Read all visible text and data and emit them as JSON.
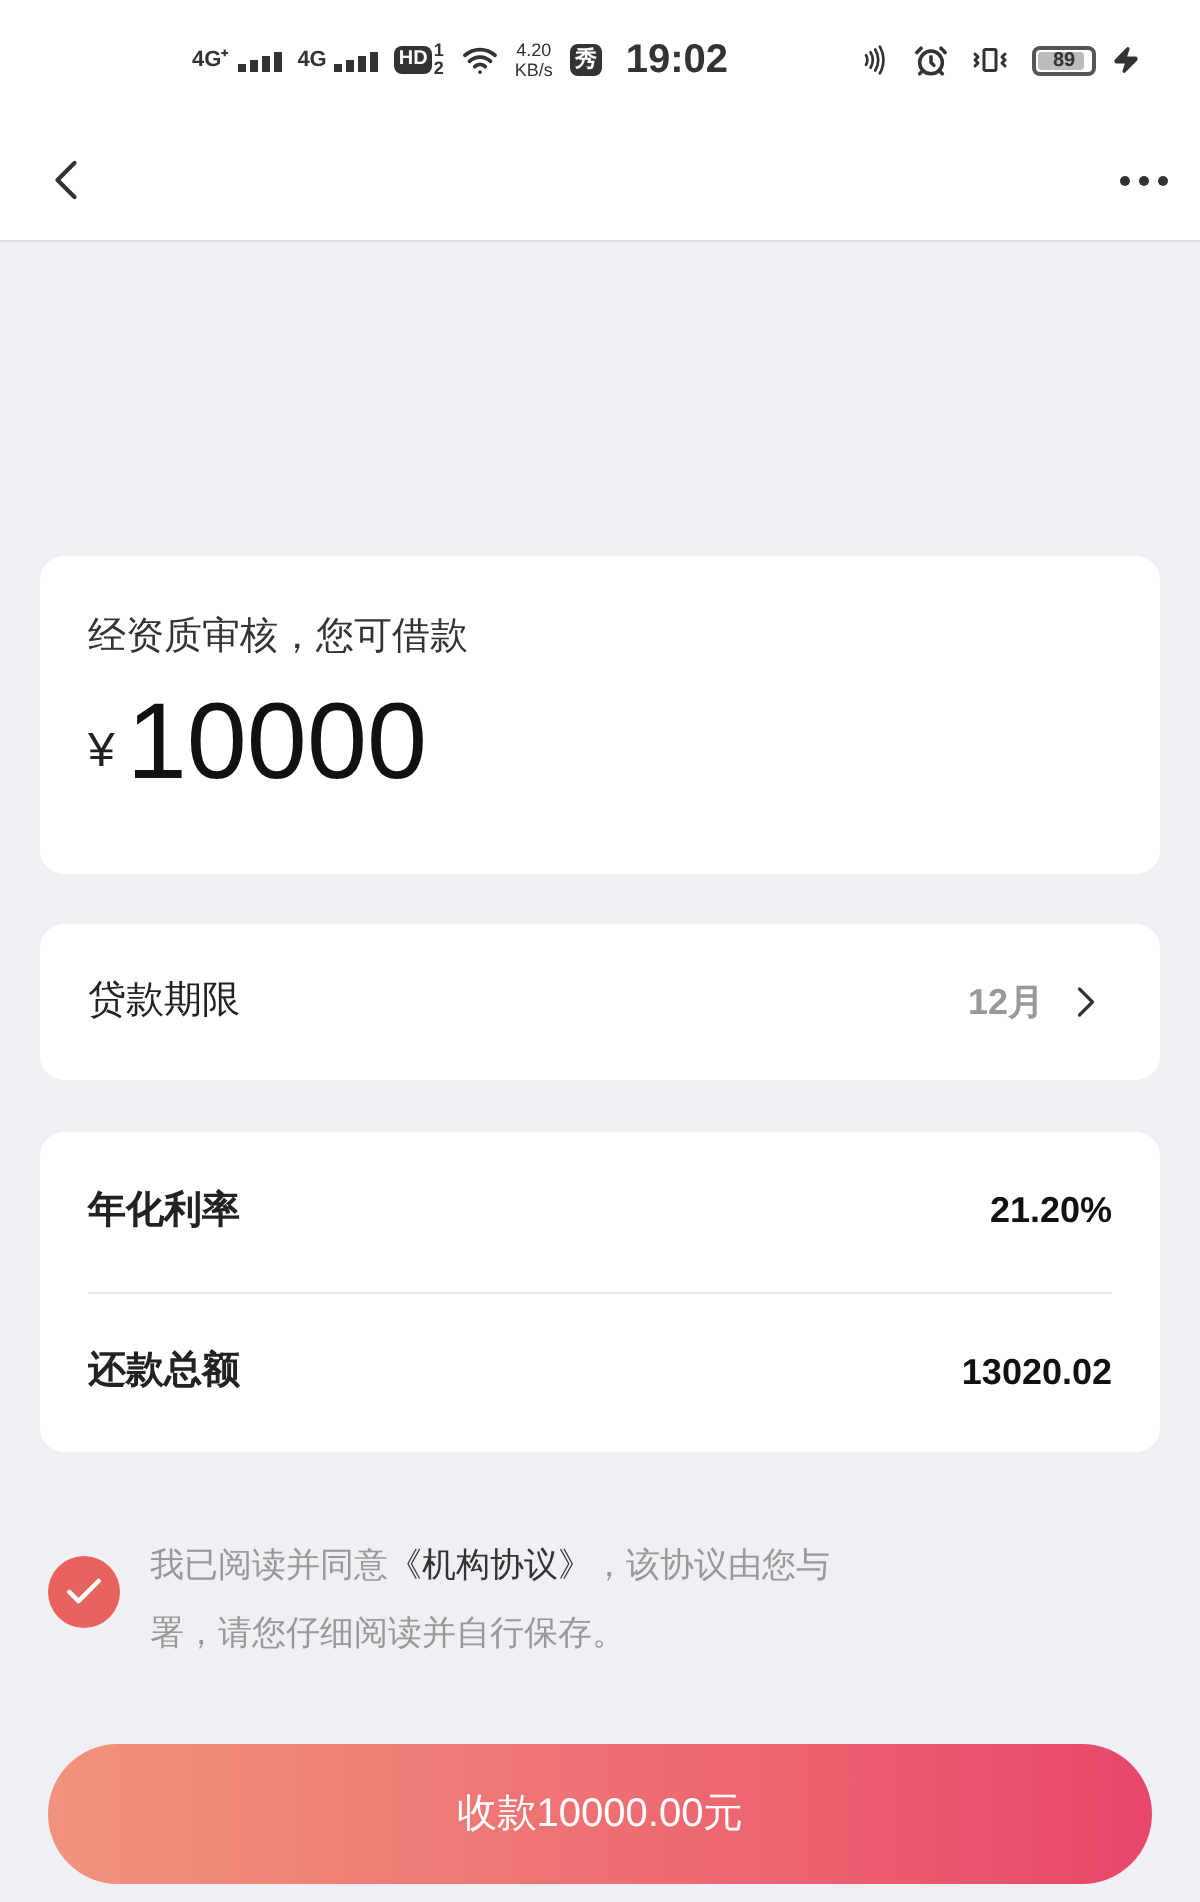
{
  "status_bar": {
    "network_1": "4G⁺",
    "network_2": "4G",
    "hd": "HD",
    "hd_slots": "1 2",
    "speed": "4.20 KB/s",
    "carrier_badge": "秀",
    "time": "19:02",
    "battery": "89"
  },
  "credit": {
    "title": "经资质审核，您可借款",
    "currency": "¥",
    "amount": "10000"
  },
  "term": {
    "label": "贷款期限",
    "value": "12月"
  },
  "details": [
    {
      "label": "年化利率",
      "value": "21.20%"
    },
    {
      "label": "还款总额",
      "value": "13020.02"
    }
  ],
  "agreement": {
    "checked": true,
    "before": "我已阅读并同意",
    "link": "《机构协议》",
    "after": "，该协议由您与署，请您仔细阅读并自行保存。"
  },
  "submit": "收款10000.00元"
}
